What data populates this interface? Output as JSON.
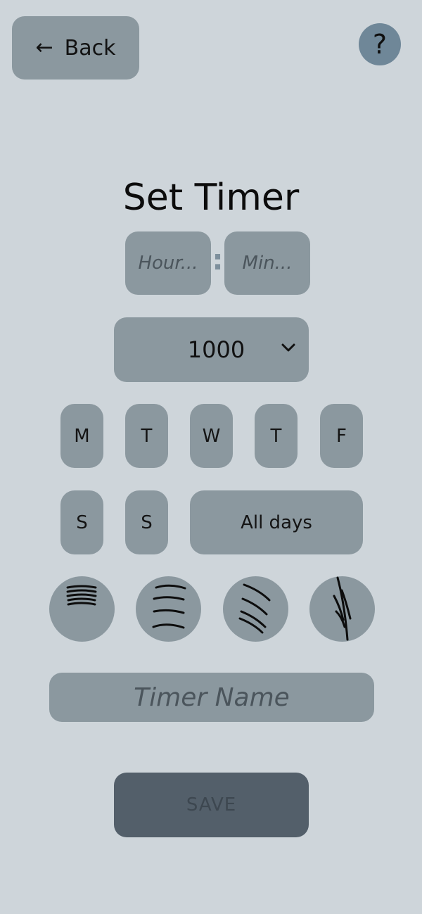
{
  "header": {
    "back_label": "Back",
    "help_label": "?"
  },
  "title": "Set Timer",
  "time": {
    "hour_placeholder": "Hour...",
    "minute_placeholder": "Min...",
    "separator": ":"
  },
  "interval": {
    "selected": "1000"
  },
  "days": {
    "items": [
      {
        "label": "M"
      },
      {
        "label": "T"
      },
      {
        "label": "W"
      },
      {
        "label": "T"
      },
      {
        "label": "F"
      },
      {
        "label": "S"
      },
      {
        "label": "S"
      }
    ],
    "all_label": "All days"
  },
  "wave_options": [
    {
      "icon": "flat-waves-icon"
    },
    {
      "icon": "curved-waves-icon"
    },
    {
      "icon": "diagonal-waves-icon"
    },
    {
      "icon": "steep-waves-icon"
    }
  ],
  "timer_name": {
    "placeholder": "Timer Name"
  },
  "save_label": "SAVE",
  "colors": {
    "background": "#ced5da",
    "control": "#8b989f",
    "help": "#6f8798",
    "save": "#535f6a"
  }
}
